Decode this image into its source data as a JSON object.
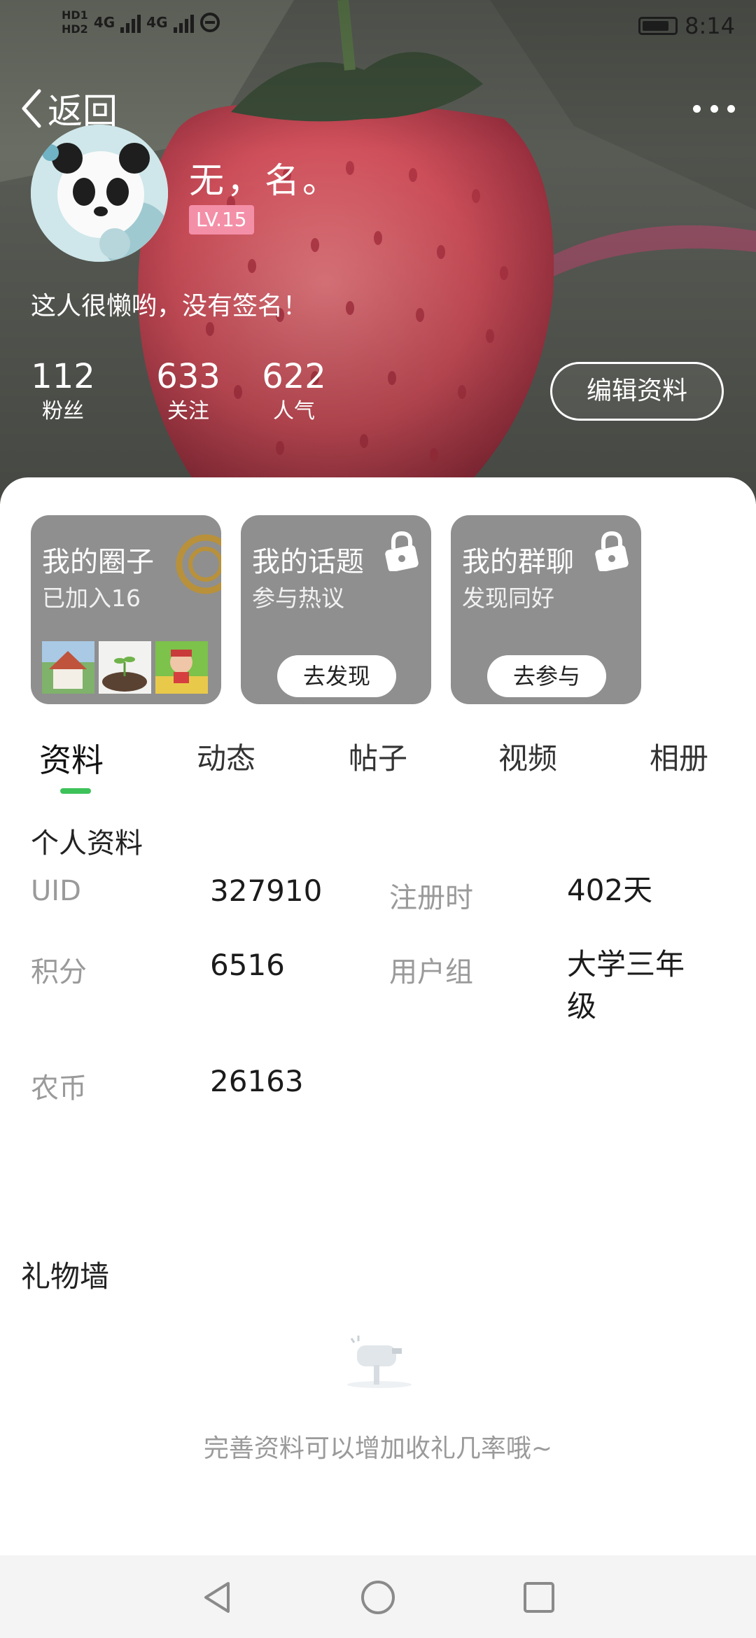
{
  "status_bar": {
    "hd_top": "HD1",
    "hd_bottom": "HD2",
    "net1": "4G",
    "net2": "4G",
    "time": "8:14"
  },
  "top_bar": {
    "back_label": "返回",
    "back_icon": "chevron-left-icon",
    "more_icon": "more-dots-icon"
  },
  "profile": {
    "name": "无，名。",
    "level": "LV.15",
    "signature": "这人很懒哟，没有签名！",
    "stats": [
      {
        "value": "112",
        "label": "粉丝"
      },
      {
        "value": "633",
        "label": "关注"
      },
      {
        "value": "622",
        "label": "人气"
      }
    ],
    "edit_label": "编辑资料"
  },
  "cards": [
    {
      "title": "我的圈子",
      "subtitle": "已加入16"
    },
    {
      "title": "我的话题",
      "subtitle": "参与热议",
      "action": "去发现",
      "icon": "lock-icon"
    },
    {
      "title": "我的群聊",
      "subtitle": "发现同好",
      "action": "去参与",
      "icon": "lock-icon"
    }
  ],
  "tabs": [
    "资料",
    "动态",
    "帖子",
    "视频",
    "相册"
  ],
  "active_tab": "资料",
  "accent_color": "#3ec25a",
  "profile_section": {
    "title": "个人资料",
    "rows": [
      {
        "k1": "UID",
        "v1": "327910",
        "k2": "注册时",
        "v2": "402天"
      },
      {
        "k1": "积分",
        "v1": "6516",
        "k2": "用户组",
        "v2": "大学三年级"
      },
      {
        "k1": "农币",
        "v1": "26163"
      }
    ]
  },
  "gift_wall": {
    "title": "礼物墙",
    "icon": "mailbox-icon",
    "hint": "完善资料可以增加收礼几率哦~"
  },
  "nav": {
    "back_icon": "triangle-back-icon",
    "home_icon": "circle-home-icon",
    "recents_icon": "square-recents-icon"
  }
}
